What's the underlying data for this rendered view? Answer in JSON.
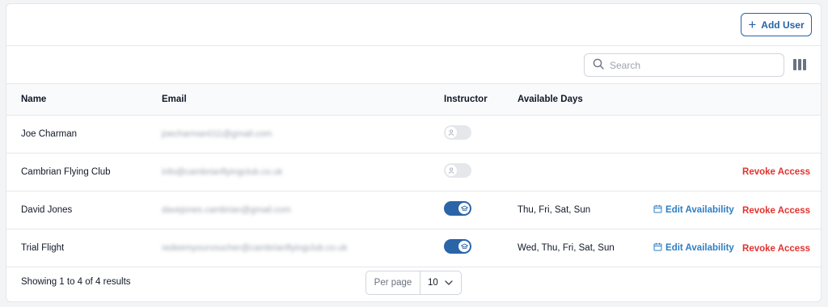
{
  "header": {
    "add_user_label": "Add User"
  },
  "toolbar": {
    "search_placeholder": "Search",
    "columns_icon": "columns-icon"
  },
  "table": {
    "columns": [
      "Name",
      "Email",
      "Instructor",
      "Available Days"
    ],
    "rows": [
      {
        "name": "Joe Charman",
        "email": "joecharman011@gmail.com",
        "instructor": false,
        "available_days": "",
        "edit_availability": "",
        "revoke": ""
      },
      {
        "name": "Cambrian Flying Club",
        "email": "info@cambrianflyingclub.co.uk",
        "instructor": false,
        "available_days": "",
        "edit_availability": "",
        "revoke": "Revoke Access"
      },
      {
        "name": "David Jones",
        "email": "davejones.cambrian@gmail.com",
        "instructor": true,
        "available_days": "Thu, Fri, Sat, Sun",
        "edit_availability": "Edit Availability",
        "revoke": "Revoke Access"
      },
      {
        "name": "Trial Flight",
        "email": "redeemyourvoucher@cambrianflyingclub.co.uk",
        "instructor": true,
        "available_days": "Wed, Thu, Fri, Sat, Sun",
        "edit_availability": "Edit Availability",
        "revoke": "Revoke Access"
      }
    ]
  },
  "footer": {
    "results_text": "Showing 1 to 4 of 4 results",
    "per_page_label": "Per page",
    "per_page_value": "10"
  },
  "colors": {
    "primary": "#2563a8",
    "toggle_on": "#2a65a8",
    "toggle_off": "#e5e7eb",
    "link_blue": "#2f7ec4",
    "danger": "#e1332f"
  }
}
